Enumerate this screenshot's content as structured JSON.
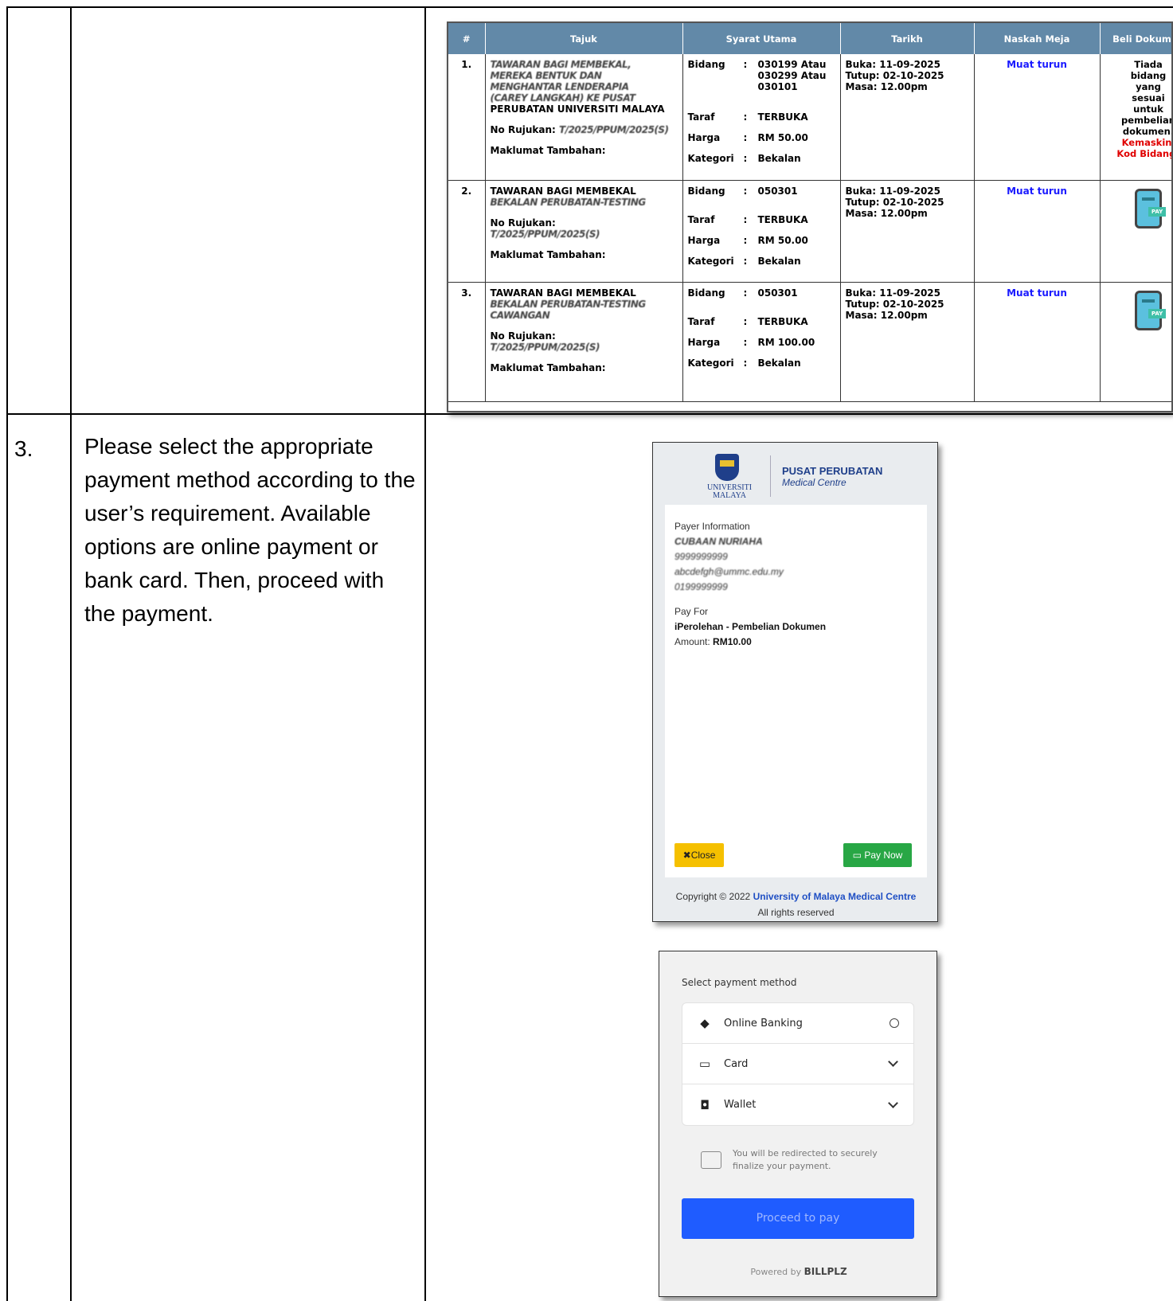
{
  "step": {
    "number": "3.",
    "instruction": "Please select the appropriate payment method according to the user’s requirement. Available options are online payment or bank card. Then, proceed with the payment."
  },
  "tender_table": {
    "headers": [
      "#",
      "Tajuk",
      "Syarat Utama",
      "Tarikh",
      "Naskah Meja",
      "Beli Dokumen"
    ],
    "labels": {
      "bidang": "Bidang",
      "taraf": "Taraf",
      "harga": "Harga",
      "kategori": "Kategori",
      "no_rujukan": "No Rujukan:",
      "maklumat": "Maklumat Tambahan:",
      "colon": ":"
    },
    "rows": [
      {
        "num": "1.",
        "title_lines": [
          "TAWARAN BAGI MEMBEKAL,",
          "MEREKA BENTUK DAN",
          "MENGHANTAR LENDERAPIA",
          "(CAREY LANGKAH) KE PUSAT",
          "PERUBATAN UNIVERSITI MALAYA"
        ],
        "rujukan": "T/2025/PPUM/2025(S)",
        "bidang": "030199 Atau 030299 Atau 030101",
        "taraf": "TERBUKA",
        "harga": "RM 50.00",
        "kategori": "Bekalan",
        "buka": "Buka: 11-09-2025",
        "tutup": "Tutup: 02-10-2025",
        "masa": "Masa: 12.00pm",
        "naskah": "Muat turun",
        "beli": [
          "Tiada",
          "bidang",
          "yang",
          "sesuai",
          "untuk",
          "pembelian",
          "dokumen."
        ],
        "beli_warn": [
          "Kemaskini",
          "Kod Bidang!"
        ]
      },
      {
        "num": "2.",
        "title_lines": [
          "TAWARAN BAGI MEMBEKAL",
          "BEKALAN PERUBATAN-TESTING"
        ],
        "rujukan": "T/2025/PPUM/2025(S)",
        "bidang": "050301",
        "taraf": "TERBUKA",
        "harga": "RM 50.00",
        "kategori": "Bekalan",
        "buka": "Buka: 11-09-2025",
        "tutup": "Tutup: 02-10-2025",
        "masa": "Masa: 12.00pm",
        "naskah": "Muat turun",
        "pay_label": "PAY"
      },
      {
        "num": "3.",
        "title_lines": [
          "TAWARAN BAGI MEMBEKAL",
          "BEKALAN PERUBATAN-TESTING",
          "CAWANGAN"
        ],
        "rujukan": "T/2025/PPUM/2025(S)",
        "bidang": "050301",
        "taraf": "TERBUKA",
        "harga": "RM 100.00",
        "kategori": "Bekalan",
        "buka": "Buka: 11-09-2025",
        "tutup": "Tutup: 02-10-2025",
        "masa": "Masa: 12.00pm",
        "naskah": "Muat turun",
        "pay_label": "PAY"
      }
    ]
  },
  "payment_modal": {
    "logo_text": [
      "UNIVERSITI",
      "MALAYA"
    ],
    "org_title": "PUSAT PERUBATAN",
    "org_subtitle": "Medical Centre",
    "payer_label": "Payer Information",
    "payer_name": "CUBAAN NURIAHA",
    "payer_id": "9999999999",
    "payer_email": "abcdefgh@ummc.edu.my",
    "payer_phone": "0199999999",
    "pay_for_label": "Pay For",
    "pay_for_value": "iPerolehan - Pembelian Dokumen",
    "amount_label": "Amount:",
    "amount_value": "RM10.00",
    "close_label": "Close",
    "pay_now_label": "Pay Now",
    "copyright_prefix": "Copyright © 2022",
    "copyright_org": "University of Malaya Medical Centre",
    "rights": "All rights reserved"
  },
  "billplz": {
    "title": "Select payment method",
    "options": [
      {
        "label": "Online Banking",
        "icon": "diamond-icon",
        "control": "radio"
      },
      {
        "label": "Card",
        "icon": "card-icon",
        "control": "chevron"
      },
      {
        "label": "Wallet",
        "icon": "wallet-icon",
        "control": "chevron"
      }
    ],
    "redirect_note": "You will be redirected to securely finalize your payment.",
    "proceed_label": "Proceed to pay",
    "powered_prefix": "Powered by",
    "powered_brand": "BILLPLZ"
  }
}
